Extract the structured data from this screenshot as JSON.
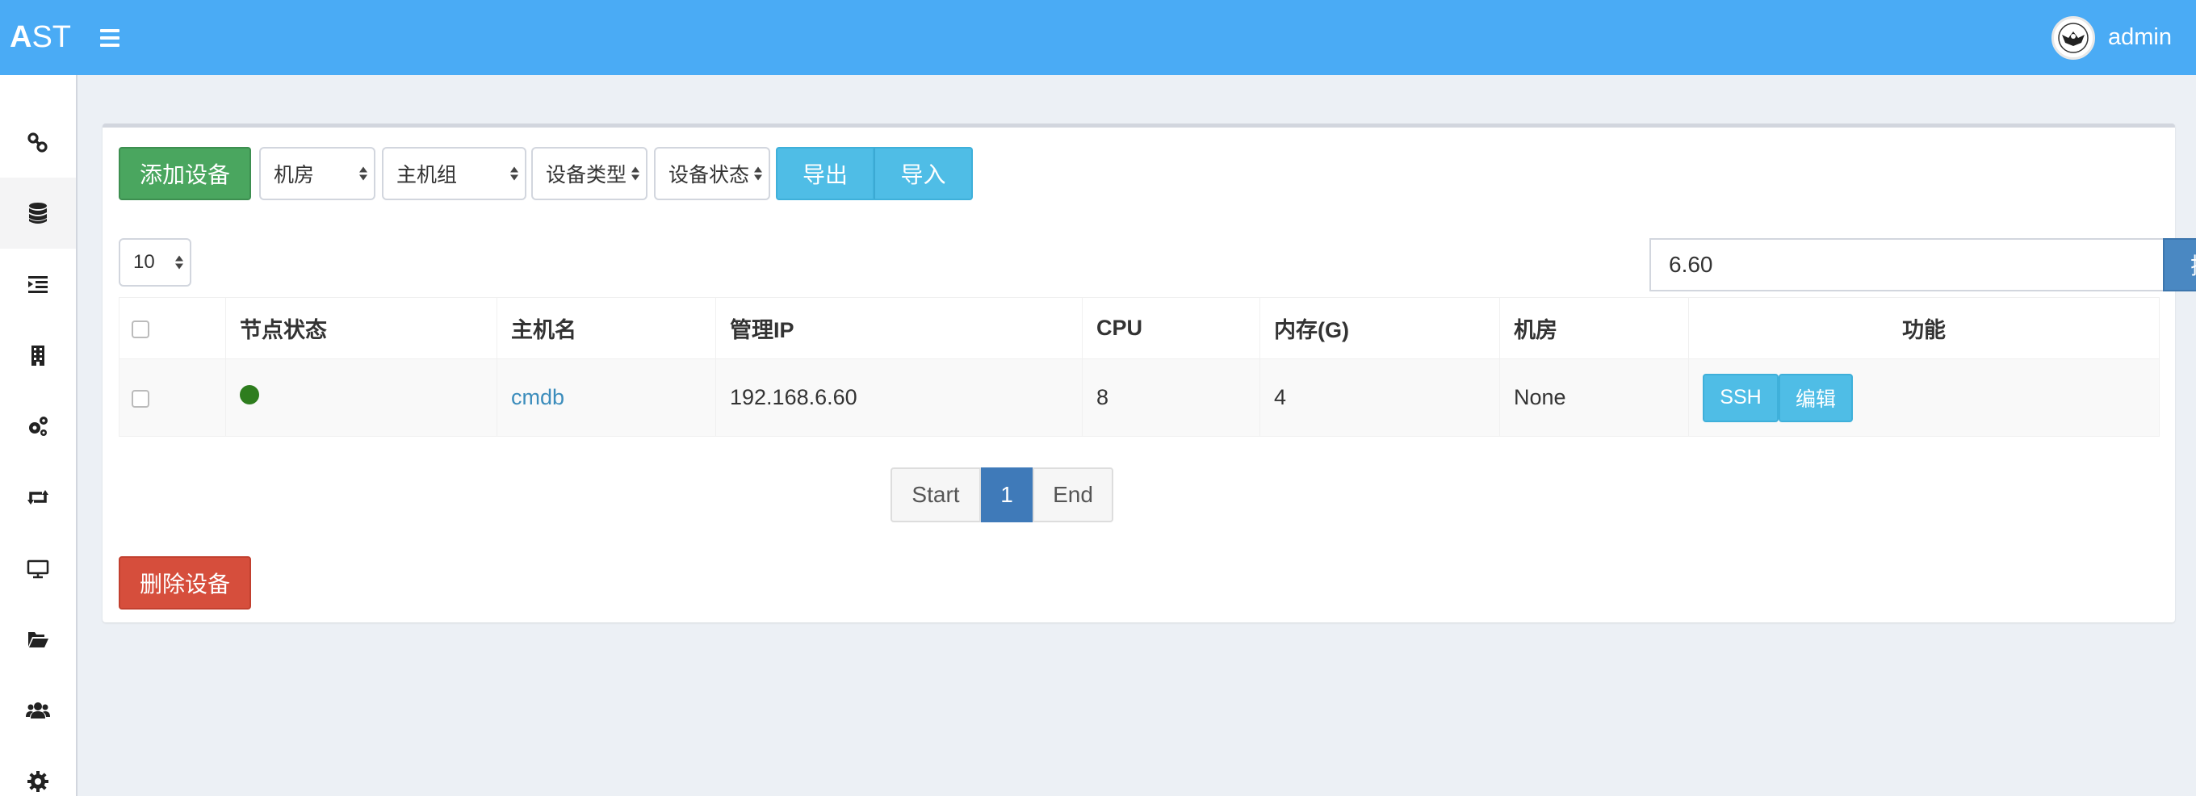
{
  "app": {
    "logo_bold": "A",
    "logo_rest": "ST",
    "user_name": "admin"
  },
  "sidebar": {
    "items": [
      {
        "icon": "link-icon"
      },
      {
        "icon": "database-icon",
        "active": true
      },
      {
        "icon": "indent-list-icon"
      },
      {
        "icon": "building-icon"
      },
      {
        "icon": "gears-icon"
      },
      {
        "icon": "retweet-icon"
      },
      {
        "icon": "monitor-icon"
      },
      {
        "icon": "folder-open-icon"
      },
      {
        "icon": "users-icon"
      },
      {
        "icon": "gear-icon"
      }
    ]
  },
  "toolbar": {
    "add_label": "添加设备",
    "filters": [
      "机房",
      "主机组",
      "设备类型",
      "设备状态"
    ],
    "export_label": "导出",
    "import_label": "导入",
    "page_size": "10",
    "search_value": "6.60",
    "search_label": "搜索"
  },
  "table": {
    "headers": [
      "节点状态",
      "主机名",
      "管理IP",
      "CPU",
      "内存(G)",
      "机房",
      "功能"
    ],
    "rows": [
      {
        "status_color": "#2e7d1e",
        "hostname": "cmdb",
        "ip": "192.168.6.60",
        "cpu": "8",
        "memory": "4",
        "room": "None",
        "actions": [
          "SSH",
          "编辑"
        ]
      }
    ]
  },
  "pagination": {
    "start_label": "Start",
    "current": "1",
    "end_label": "End"
  },
  "delete_label": "删除设备",
  "colors": {
    "header": "#4aabf5",
    "success": "#4aa65f",
    "danger": "#d64e3c",
    "info": "#4fbde6",
    "primary": "#4a88c2"
  }
}
